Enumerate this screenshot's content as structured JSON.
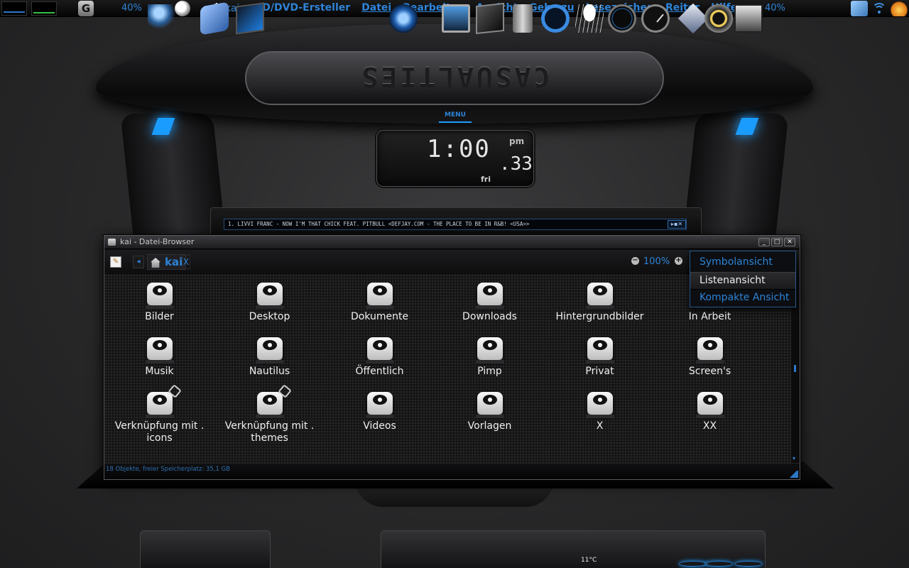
{
  "top_panel": {
    "cpu_percent_left": "40%",
    "user": "kai",
    "app_name": "CD/DVD-Ersteller",
    "menu": [
      "Datei",
      "Bearbeiten",
      "Ansicht",
      "Gehe zu",
      "Lesezeichen",
      "Reiter",
      "Hilfe"
    ],
    "cpu_percent_right": "40%"
  },
  "desktop": {
    "logo_text": "CASUALTIES",
    "clock": {
      "menu_label": "MENU",
      "time": "1:00",
      "seconds": ".33",
      "ampm": "pm",
      "day": "fri"
    },
    "ticker": {
      "text": "1. LIVVI FRANC - NOW I'M THAT CHICK FEAT. PITBULL <DEFJAY.COM - THE PLACE TO BE IN R&B! <USA>>",
      "controls": "▸▪✕"
    }
  },
  "window": {
    "title": "kai - Datei-Browser",
    "controls": [
      "_",
      "□",
      "✕"
    ],
    "toolbar": {
      "location": "kai",
      "close_location": "X",
      "zoom": "100%"
    },
    "items": [
      {
        "name": "Bilder",
        "link": false
      },
      {
        "name": "Desktop",
        "link": false
      },
      {
        "name": "Dokumente",
        "link": false
      },
      {
        "name": "Downloads",
        "link": false
      },
      {
        "name": "Hintergrundbilder",
        "link": false
      },
      {
        "name": "In Arbeit",
        "link": false
      },
      {
        "name": "Musik",
        "link": false
      },
      {
        "name": "Nautilus",
        "link": false
      },
      {
        "name": "Öffentlich",
        "link": false
      },
      {
        "name": "Pimp",
        "link": false
      },
      {
        "name": "Privat",
        "link": false
      },
      {
        "name": "Screen's",
        "link": false
      },
      {
        "name": "Verknüpfung mit . icons",
        "link": true
      },
      {
        "name": "Verknüpfung mit . themes",
        "link": true
      },
      {
        "name": "Videos",
        "link": false
      },
      {
        "name": "Vorlagen",
        "link": false
      },
      {
        "name": "X",
        "link": false
      },
      {
        "name": "XX",
        "link": false
      }
    ],
    "status": "18 Objekte, freier Speicherplatz: 35,1 GB",
    "view_menu": {
      "options": [
        "Symbolansicht",
        "Listenansicht",
        "Kompakte Ansicht"
      ],
      "selected": "Listenansicht"
    }
  },
  "dock": {
    "weather_temp": "11°C"
  },
  "colors": {
    "accent": "#2e83d6",
    "glow": "#1a9cff",
    "window_bg": "#151516"
  }
}
